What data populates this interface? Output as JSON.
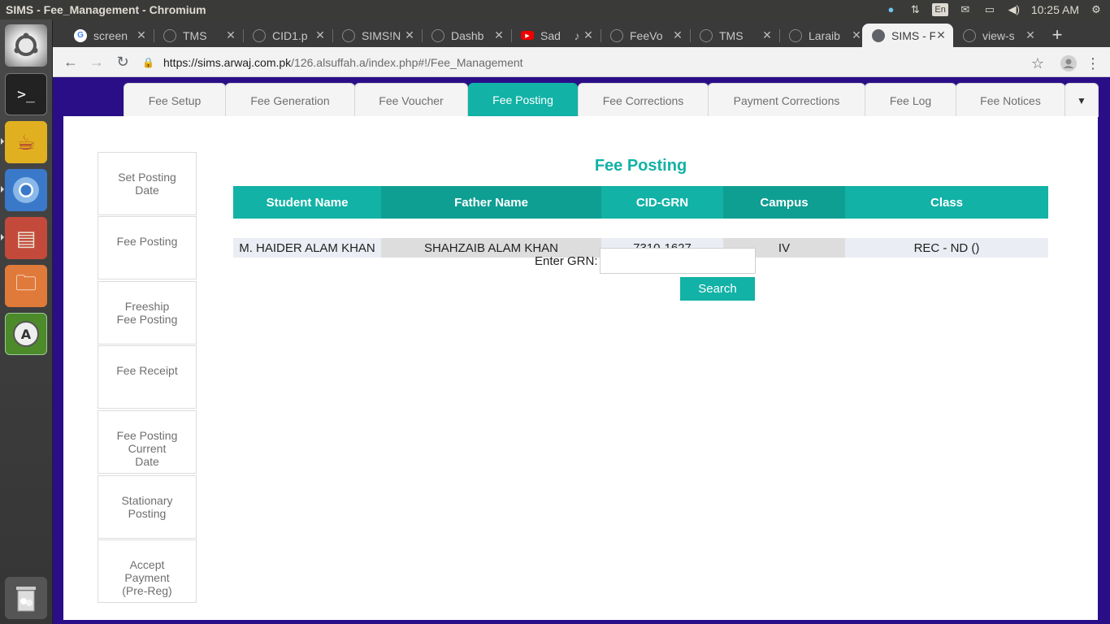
{
  "window": {
    "title": "SIMS - Fee_Management - Chromium"
  },
  "tray": {
    "keyboard": "En",
    "time": "10:25 AM"
  },
  "browser": {
    "tabs": [
      {
        "label": "screen",
        "favicon": "google-icon",
        "active": false
      },
      {
        "label": "TMS",
        "favicon": "globe-icon",
        "active": false
      },
      {
        "label": "CID1.p",
        "favicon": "globe-icon",
        "active": false
      },
      {
        "label": "SIMS!N",
        "favicon": "globe-icon",
        "active": false
      },
      {
        "label": "Dashb",
        "favicon": "globe-icon",
        "active": false
      },
      {
        "label": "Sad",
        "favicon": "youtube-icon",
        "active": false
      },
      {
        "label": "FeeVo",
        "favicon": "globe-icon",
        "active": false
      },
      {
        "label": "TMS",
        "favicon": "globe-icon",
        "active": false
      },
      {
        "label": "Laraib",
        "favicon": "globe-icon",
        "active": false
      },
      {
        "label": "SIMS - F",
        "favicon": "globe-icon",
        "active": true
      },
      {
        "label": "view-s",
        "favicon": "globe-icon",
        "active": false
      }
    ],
    "url_host": "https://sims.arwaj.com.pk",
    "url_path": "/126.alsuffah.a/index.php#!/Fee_Management"
  },
  "nav": {
    "tabs": [
      "Fee Setup",
      "Fee Generation",
      "Fee Voucher",
      "Fee Posting",
      "Fee Corrections",
      "Payment Corrections",
      "Fee Log",
      "Fee Notices"
    ],
    "active": "Fee Posting",
    "more": "▼"
  },
  "side_menu": [
    {
      "lines": [
        "Set Posting",
        "Date"
      ]
    },
    {
      "lines": [
        "Fee Posting"
      ]
    },
    {
      "lines": [
        "Freeship",
        "Fee Posting"
      ]
    },
    {
      "lines": [
        "Fee Receipt"
      ]
    },
    {
      "lines": [
        "Fee Posting",
        "Current",
        "Date"
      ]
    },
    {
      "lines": [
        "Stationary",
        "Posting"
      ]
    },
    {
      "lines": [
        "Accept",
        "Payment",
        "(Pre-Reg)"
      ]
    }
  ],
  "main": {
    "heading": "Fee Posting",
    "table": {
      "headers": [
        "Student Name",
        "Father Name",
        "CID-GRN",
        "Campus",
        "Class"
      ],
      "rows": [
        [
          "M. HAIDER ALAM KHAN",
          "SHAHZAIB ALAM KHAN",
          "7310-1627",
          "IV",
          "REC - ND ()"
        ]
      ]
    },
    "grn_label": "Enter GRN:",
    "grn_value": "",
    "search_label": "Search"
  },
  "colors": {
    "accent": "#12b2a6",
    "page_bg": "#2a0e87",
    "header_alt": "#0e9e92"
  }
}
